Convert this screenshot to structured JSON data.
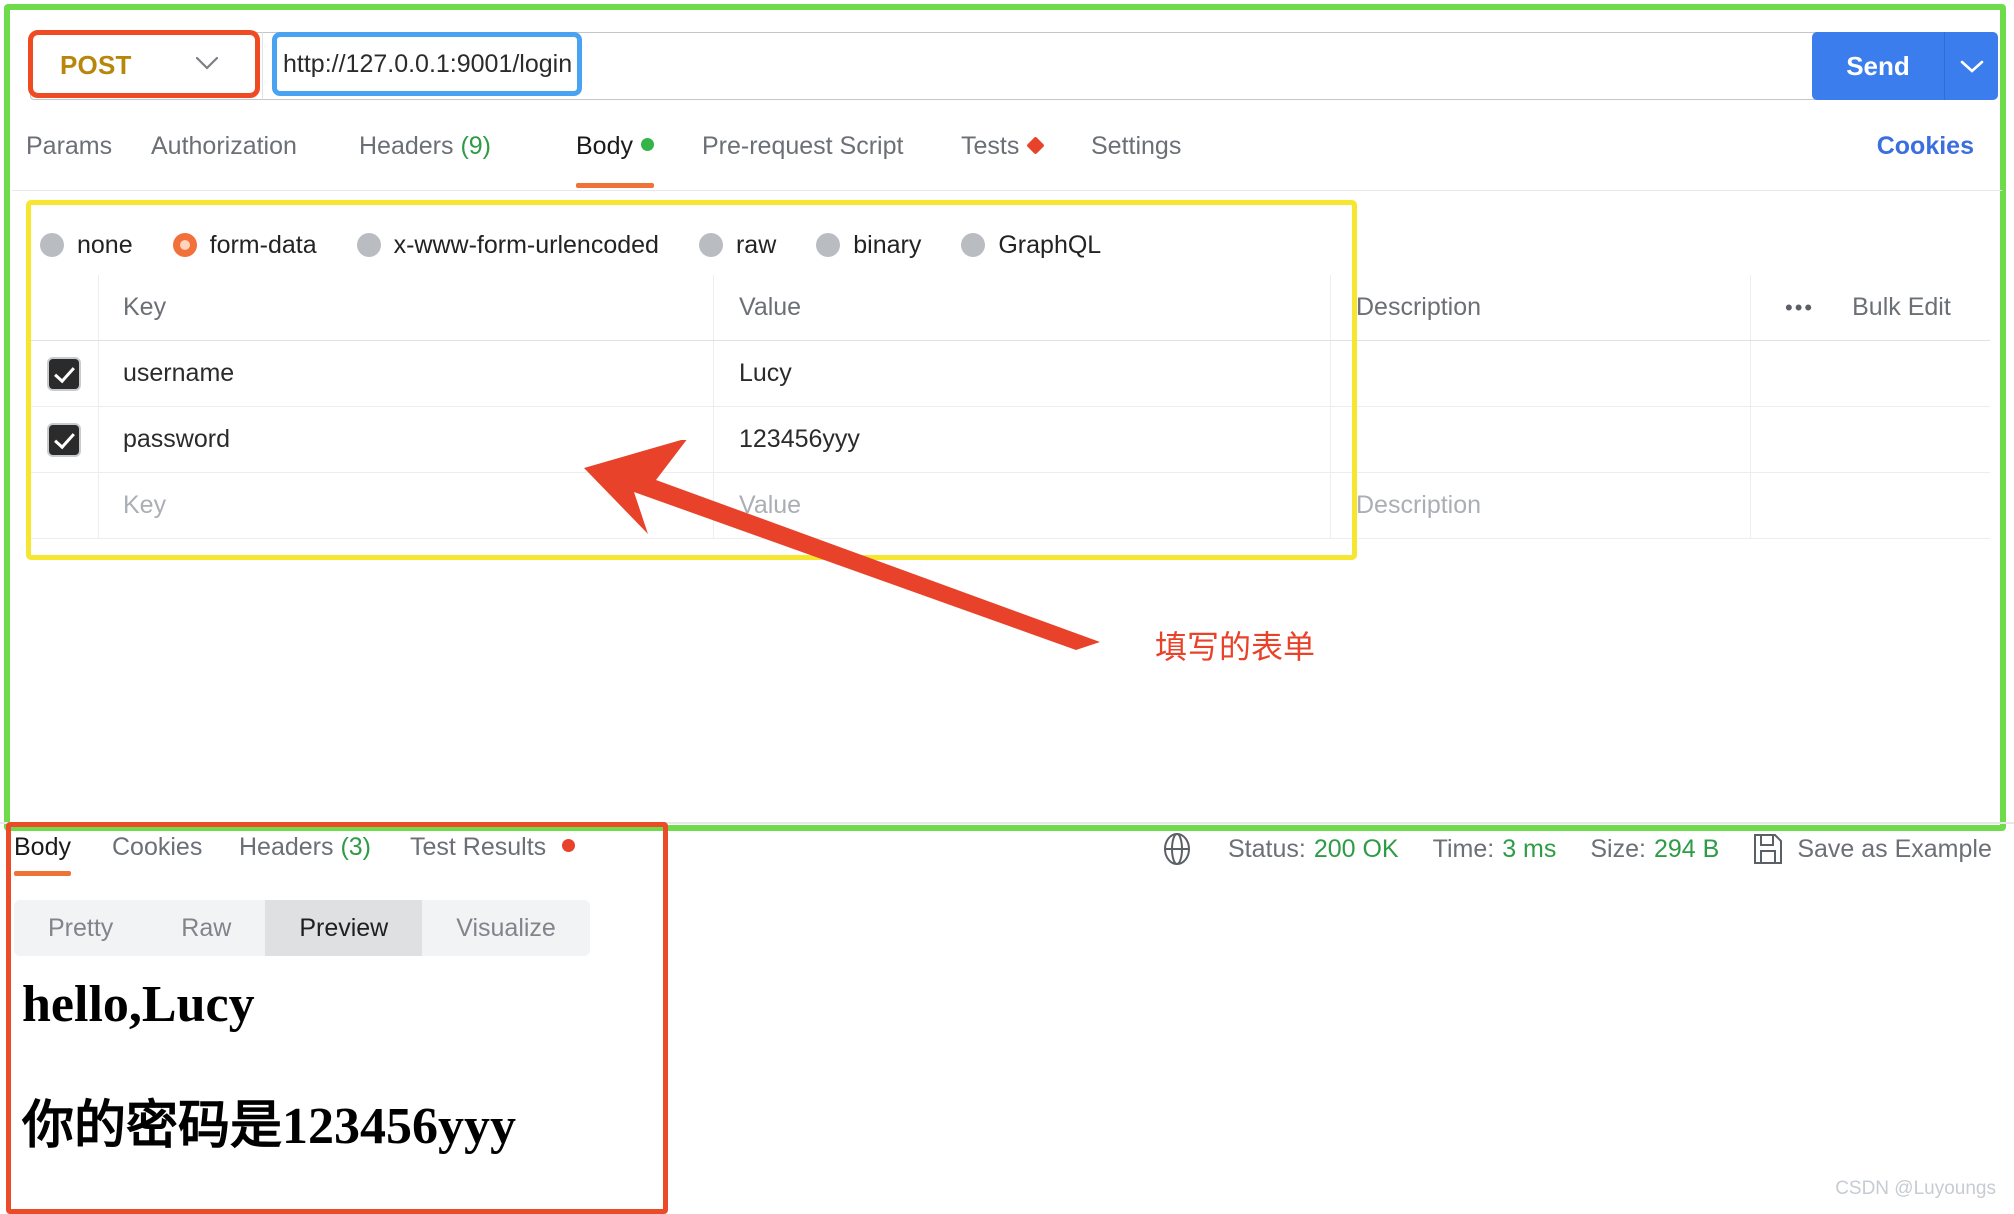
{
  "request": {
    "method": "POST",
    "url": "http://127.0.0.1:9001/login",
    "send_label": "Send",
    "cookies_link": "Cookies",
    "tabs": [
      {
        "label": "Params",
        "badge": "",
        "marker": "none",
        "active": false
      },
      {
        "label": "Authorization",
        "badge": "",
        "marker": "none",
        "active": false
      },
      {
        "label": "Headers",
        "badge": "(9)",
        "marker": "none",
        "active": false
      },
      {
        "label": "Body",
        "badge": "",
        "marker": "green-dot",
        "active": true
      },
      {
        "label": "Pre-request Script",
        "badge": "",
        "marker": "none",
        "active": false
      },
      {
        "label": "Tests",
        "badge": "",
        "marker": "red-diamond",
        "active": false
      },
      {
        "label": "Settings",
        "badge": "",
        "marker": "none",
        "active": false
      }
    ]
  },
  "body": {
    "types": [
      {
        "label": "none",
        "selected": false
      },
      {
        "label": "form-data",
        "selected": true
      },
      {
        "label": "x-www-form-urlencoded",
        "selected": false
      },
      {
        "label": "raw",
        "selected": false
      },
      {
        "label": "binary",
        "selected": false
      },
      {
        "label": "GraphQL",
        "selected": false
      }
    ],
    "columns": {
      "key": "Key",
      "value": "Value",
      "description": "Description",
      "bulk_edit": "Bulk Edit"
    },
    "rows": [
      {
        "checked": true,
        "key": "username",
        "value": "Lucy",
        "description": ""
      },
      {
        "checked": true,
        "key": "password",
        "value": "123456yyy",
        "description": ""
      }
    ],
    "placeholder_row": {
      "key": "Key",
      "value": "Value",
      "description": "Description"
    }
  },
  "annotation": {
    "text": "填写的表单",
    "color": "#e8432a"
  },
  "response": {
    "tabs": [
      {
        "label": "Body",
        "badge": "",
        "marker": "none",
        "active": true
      },
      {
        "label": "Cookies",
        "badge": "",
        "marker": "none",
        "active": false
      },
      {
        "label": "Headers",
        "badge": "(3)",
        "marker": "none",
        "active": false
      },
      {
        "label": "Test Results",
        "badge": "",
        "marker": "red-dot",
        "active": false
      }
    ],
    "meta": {
      "status_label": "Status:",
      "status_value": "200 OK",
      "time_label": "Time:",
      "time_value": "3 ms",
      "size_label": "Size:",
      "size_value": "294 B",
      "save_as_example": "Save as Example"
    },
    "view_modes": [
      {
        "label": "Pretty",
        "active": false
      },
      {
        "label": "Raw",
        "active": false
      },
      {
        "label": "Preview",
        "active": true
      },
      {
        "label": "Visualize",
        "active": false
      }
    ],
    "preview": {
      "line1": "hello,Lucy",
      "line2": "你的密码是123456yyy"
    }
  },
  "watermark": "CSDN @Luyoungs",
  "colors": {
    "accent_orange": "#ef7338",
    "send_blue": "#3b7ded",
    "method_gold": "#b8860b",
    "highlight_green": "#6ddb4a",
    "highlight_yellow": "#f7e62f",
    "highlight_red": "#ea4c29",
    "status_green": "#2e9c46"
  }
}
